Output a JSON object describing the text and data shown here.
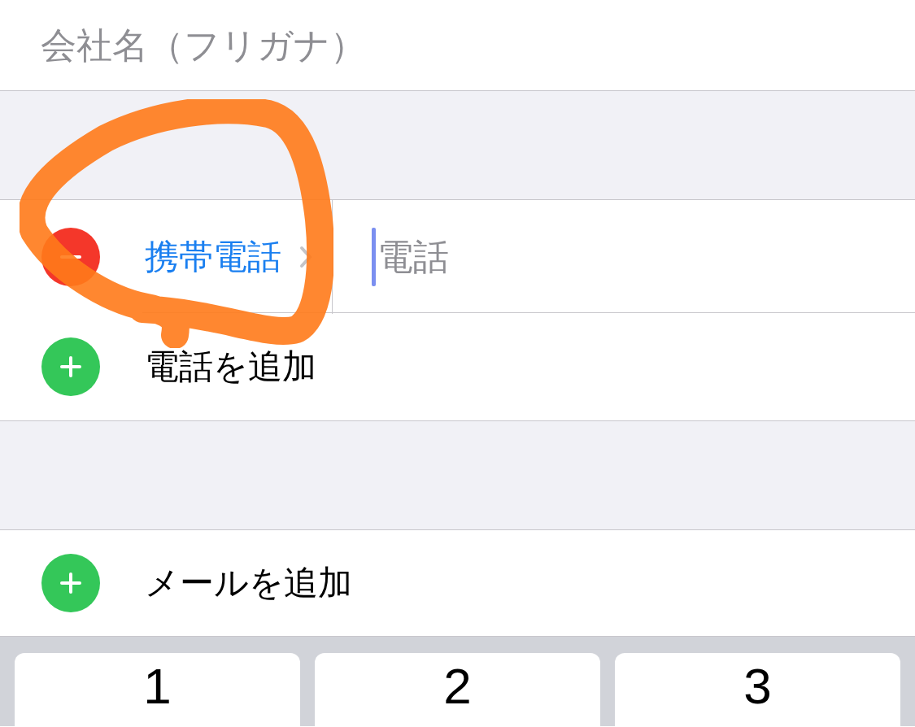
{
  "form": {
    "company_phonetic": {
      "placeholder": "会社名（フリガナ）"
    },
    "phones": [
      {
        "label": "携帯電話",
        "placeholder": "電話"
      }
    ],
    "add_phone": "電話を追加",
    "add_email": "メールを追加"
  },
  "keyboard": {
    "keys": [
      "1",
      "2",
      "3"
    ]
  }
}
